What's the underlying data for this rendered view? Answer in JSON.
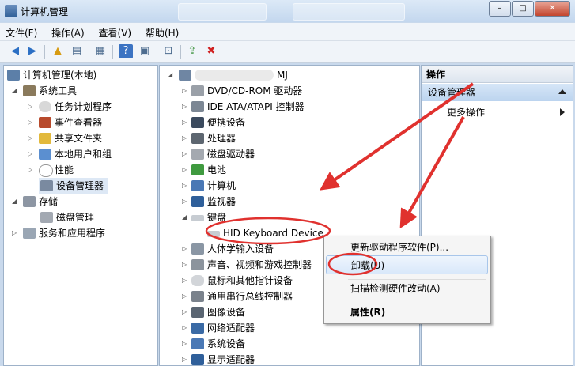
{
  "window": {
    "title": "计算机管理",
    "controls": [
      "–",
      "□",
      "✕"
    ]
  },
  "menubar": [
    "文件(F)",
    "操作(A)",
    "查看(V)",
    "帮助(H)"
  ],
  "left_tree": {
    "root": "计算机管理(本地)",
    "system_tools": "系统工具",
    "task_scheduler": "任务计划程序",
    "event_viewer": "事件查看器",
    "shared_folders": "共享文件夹",
    "local_users": "本地用户和组",
    "performance": "性能",
    "device_manager": "设备管理器",
    "storage": "存储",
    "disk_management": "磁盘管理",
    "services": "服务和应用程序"
  },
  "device_tree": {
    "computer_name_suffix": "MJ",
    "categories": [
      "DVD/CD-ROM 驱动器",
      "IDE ATA/ATAPI 控制器",
      "便携设备",
      "处理器",
      "磁盘驱动器",
      "电池",
      "计算机",
      "监视器",
      "键盘",
      "HID Keyboard Device",
      "人体学输入设备",
      "声音、视频和游戏控制器",
      "鼠标和其他指针设备",
      "通用串行总线控制器",
      "图像设备",
      "网络适配器",
      "系统设备",
      "显示适配器"
    ]
  },
  "actions_pane": {
    "header": "操作",
    "selected": "设备管理器",
    "more": "更多操作"
  },
  "context_menu": {
    "update_driver": "更新驱动程序软件(P)...",
    "uninstall": "卸载(U)",
    "scan": "扫描检测硬件改动(A)",
    "properties": "属性(R)"
  },
  "colors": {
    "annotation_red": "#e0312e",
    "selection_blue": "#cde0f7"
  }
}
